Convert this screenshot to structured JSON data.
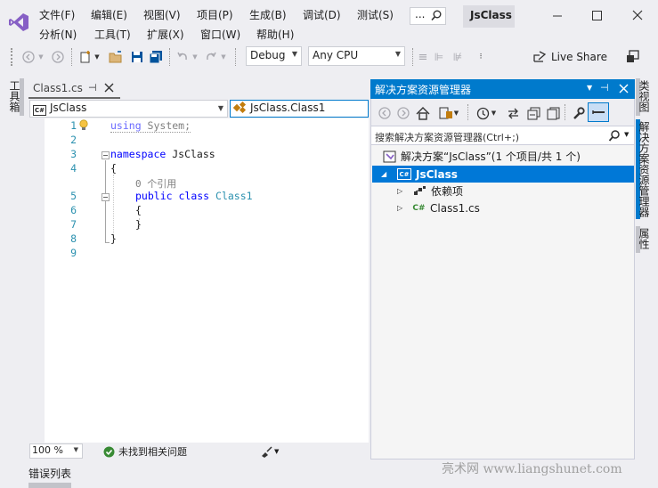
{
  "menu": {
    "row1": [
      "文件(F)",
      "编辑(E)",
      "视图(V)",
      "项目(P)",
      "生成(B)",
      "调试(D)",
      "测试(S)"
    ],
    "row2": [
      "分析(N)",
      "工具(T)",
      "扩展(X)",
      "窗口(W)",
      "帮助(H)"
    ],
    "search_placeholder": "...",
    "solution_title": "JsClass"
  },
  "toolbar": {
    "config": "Debug",
    "platform": "Any CPU",
    "live_share": "Live Share"
  },
  "left_sidebar": {
    "toolbox": "工具箱"
  },
  "editor": {
    "tab_label": "Class1.cs",
    "project_combo": "JsClass",
    "class_combo": "JsClass.Class1",
    "line_numbers": [
      "1",
      "2",
      "3",
      "4",
      "5",
      "6",
      "7",
      "8",
      "9"
    ],
    "code": {
      "l1_kw": "using",
      "l1_rest": " System;",
      "l3_kw": "namespace",
      "l3_rest": " JsClass",
      "l4": "{",
      "ref_hint": "0 个引用",
      "l5_kw1": "public",
      "l5_kw2": " class",
      "l5_type": " Class1",
      "l6": "{",
      "l7": "}",
      "l8": "}"
    },
    "zoom": "100 %",
    "status": "未找到相关问题"
  },
  "error_list": {
    "label": "错误列表"
  },
  "solution_explorer": {
    "title": "解决方案资源管理器",
    "search_placeholder": "搜索解决方案资源管理器(Ctrl+;)",
    "solution_node": "解决方案“JsClass”(1 个项目/共 1 个)",
    "project_node": "JsClass",
    "dependencies": "依赖项",
    "file": "Class1.cs"
  },
  "right_sidebar": {
    "class_view": "类视图",
    "solution_explorer": "解决方案资源管理器",
    "properties": "属性"
  },
  "watermark": "亮术网 www.liangshunet.com",
  "colors": {
    "accent": "#007acc",
    "vs_purple": "#865fc5",
    "selection": "#0078d7"
  }
}
